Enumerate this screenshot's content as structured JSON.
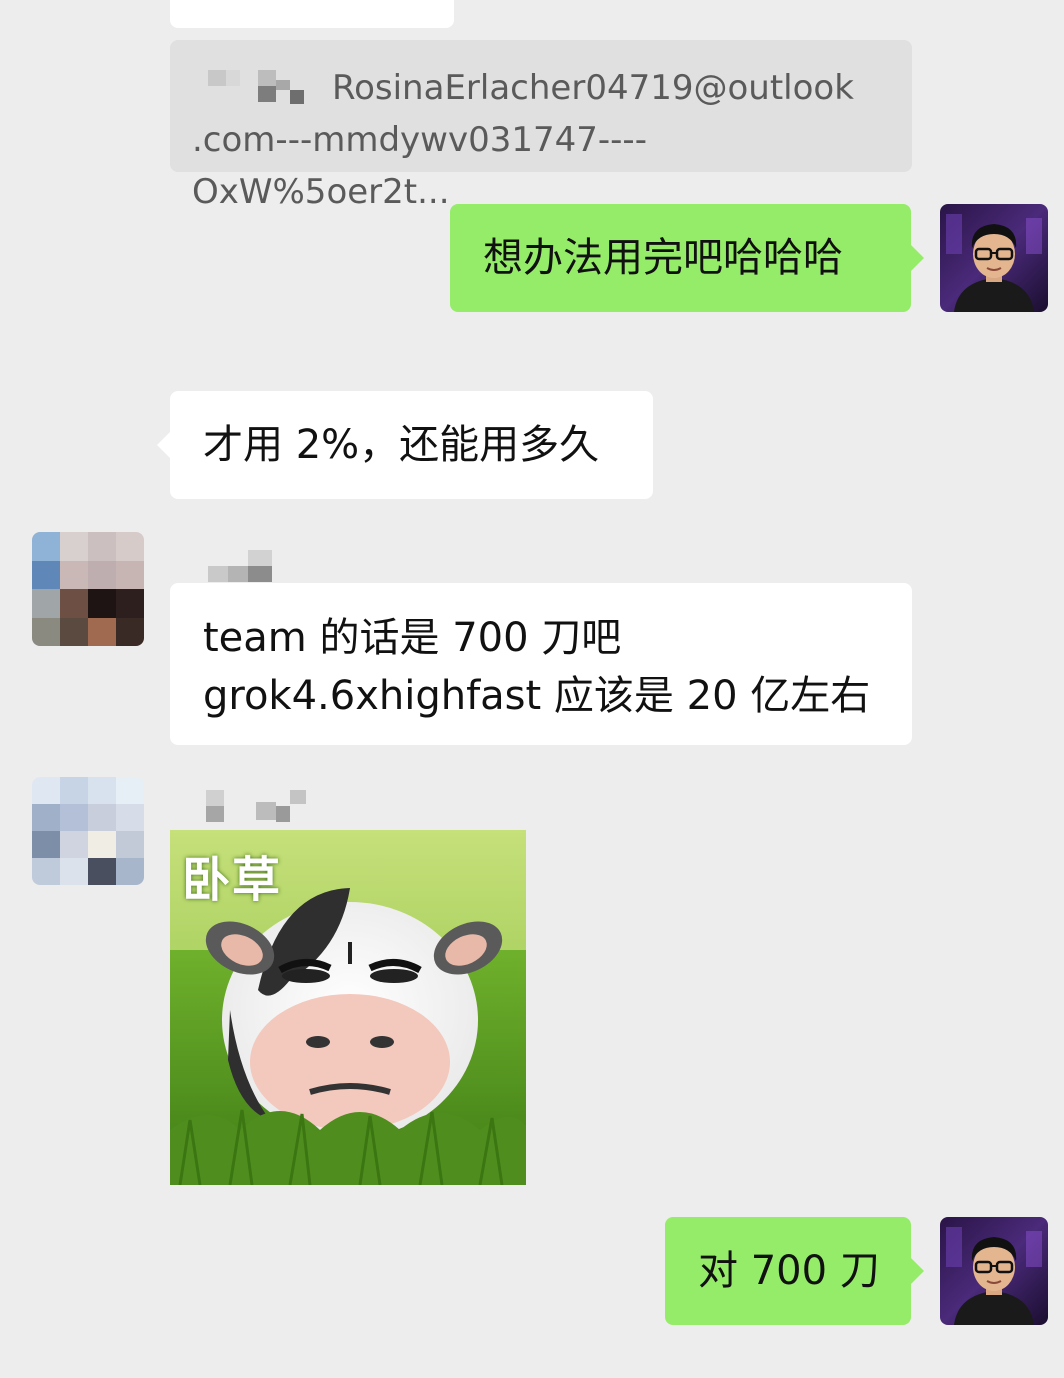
{
  "quote": {
    "line1": "RosinaErlacher04719@outlook",
    "line2": ".com---mmdywv031747----OxW%5oer2t..."
  },
  "messages": [
    {
      "side": "right",
      "text": "想办法用完吧哈哈哈"
    },
    {
      "side": "left",
      "text": "才用 2%，还能用多久"
    },
    {
      "side": "left",
      "line1": "team 的话是 700 刀吧",
      "line2": "grok4.6xhighfast 应该是 20 亿左右"
    },
    {
      "side": "left",
      "sticker_text": "卧草"
    },
    {
      "side": "right",
      "text": "对 700 刀"
    }
  ],
  "colors": {
    "background": "#ededed",
    "bubble_sent": "#95ec69",
    "bubble_received": "#ffffff",
    "quote_bubble": "#e0e0e0"
  }
}
